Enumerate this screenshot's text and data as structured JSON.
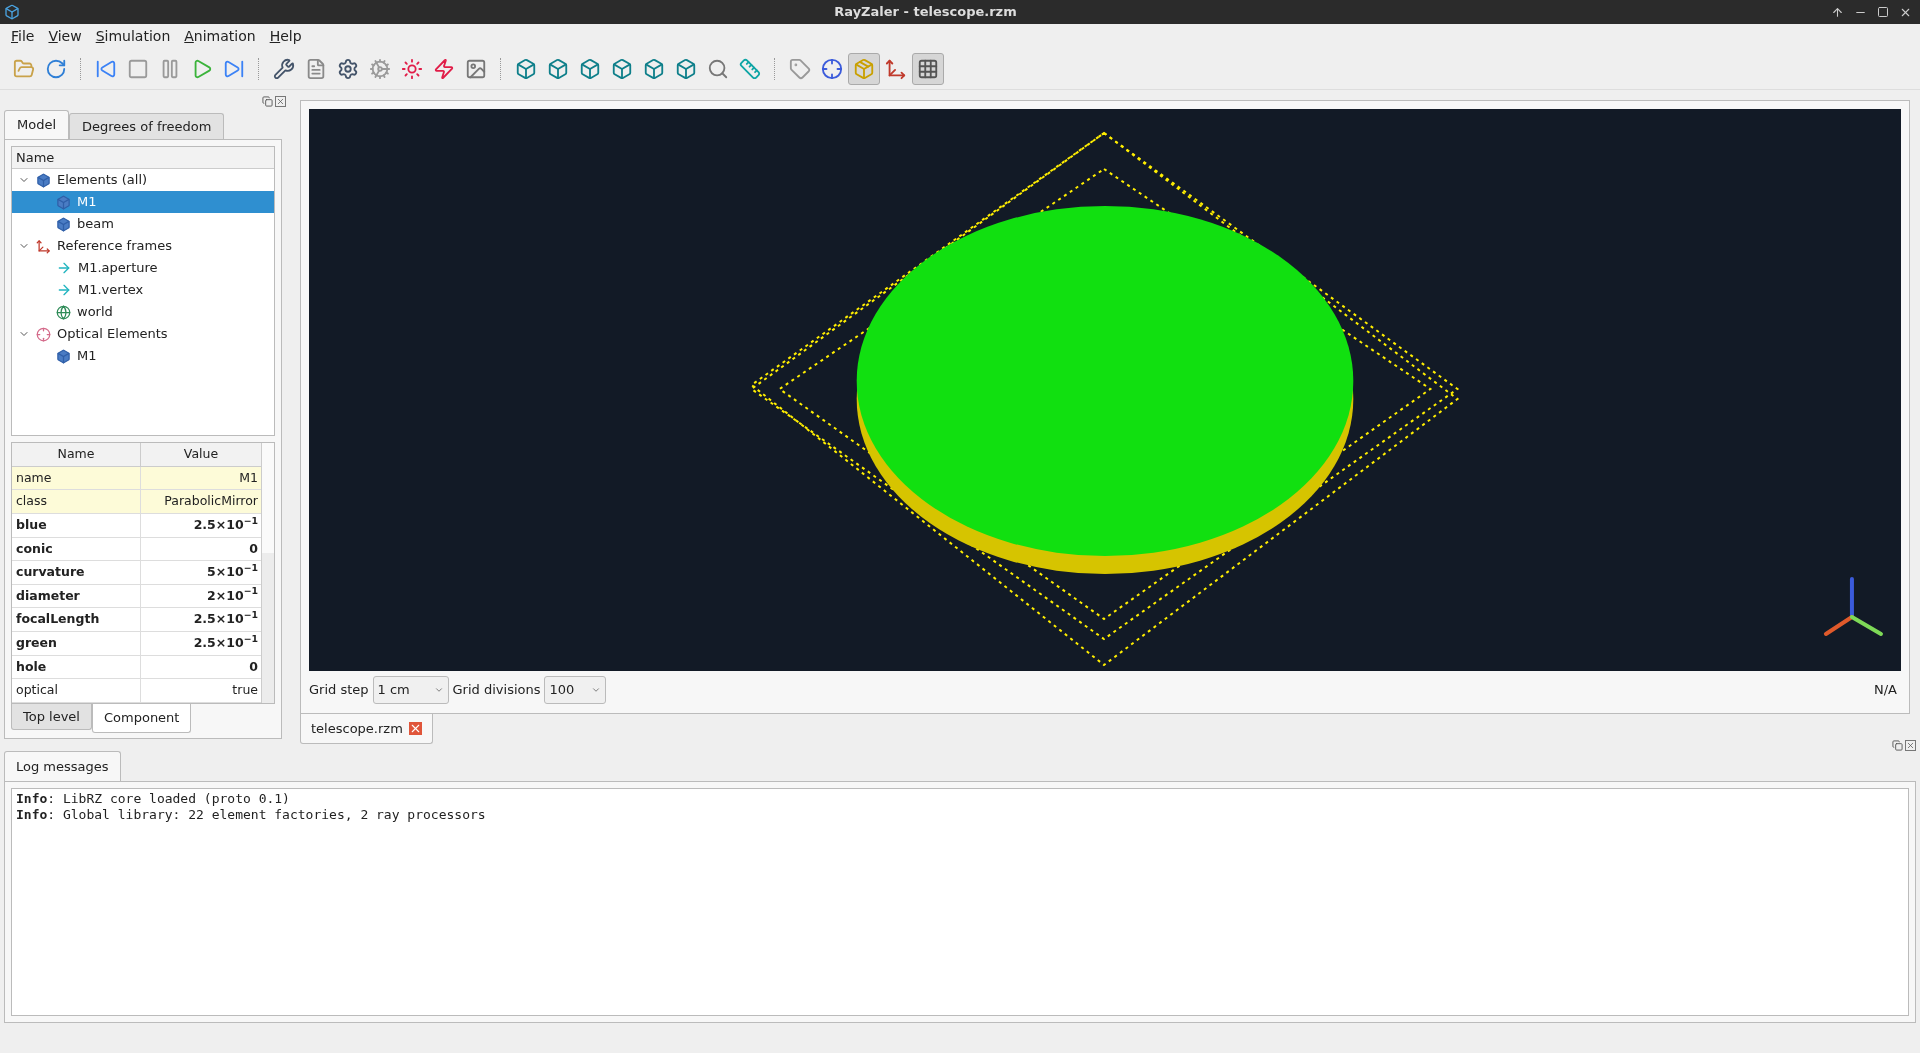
{
  "window": {
    "title": "RayZaler - telescope.rzm"
  },
  "menu": [
    {
      "label": "File"
    },
    {
      "label": "View"
    },
    {
      "label": "Simulation"
    },
    {
      "label": "Animation"
    },
    {
      "label": "Help"
    }
  ],
  "toolbar": [
    [
      {
        "kind": "open",
        "selected": false
      },
      {
        "kind": "reload",
        "selected": false
      }
    ],
    [
      {
        "kind": "rewind",
        "selected": false
      },
      {
        "kind": "stop",
        "selected": false
      },
      {
        "kind": "pause",
        "selected": false
      },
      {
        "kind": "play",
        "selected": false
      },
      {
        "kind": "forward",
        "selected": false
      }
    ],
    [
      {
        "kind": "tools",
        "selected": false
      },
      {
        "kind": "document",
        "selected": false
      },
      {
        "kind": "settings",
        "selected": false
      },
      {
        "kind": "gear",
        "selected": false
      },
      {
        "kind": "laser",
        "selected": false
      },
      {
        "kind": "beam",
        "selected": false
      },
      {
        "kind": "image",
        "selected": false
      }
    ],
    [
      {
        "kind": "cube",
        "selected": false
      },
      {
        "kind": "cube",
        "selected": false
      },
      {
        "kind": "cube",
        "selected": false
      },
      {
        "kind": "cube",
        "selected": false
      },
      {
        "kind": "cube",
        "selected": false
      },
      {
        "kind": "cube",
        "selected": false
      },
      {
        "kind": "zoom",
        "selected": false
      },
      {
        "kind": "ruler",
        "selected": false
      }
    ],
    [
      {
        "kind": "tag",
        "selected": false
      },
      {
        "kind": "crosshair",
        "selected": false
      },
      {
        "kind": "box",
        "selected": true
      },
      {
        "kind": "axes",
        "selected": false
      },
      {
        "kind": "grid",
        "selected": true
      }
    ]
  ],
  "left_tabs": [
    {
      "label": "Model",
      "selected": true
    },
    {
      "label": "Degrees of freedom",
      "selected": false
    }
  ],
  "tree": {
    "header": "Name",
    "items": [
      {
        "label": "Elements (all)",
        "kind": "cube",
        "expanded": true,
        "selected": false,
        "children": [
          {
            "label": "M1",
            "kind": "cube",
            "selected": true
          },
          {
            "label": "beam",
            "kind": "cube",
            "selected": false
          }
        ]
      },
      {
        "label": "Reference frames",
        "kind": "axes",
        "expanded": true,
        "selected": false,
        "children": [
          {
            "label": "M1.aperture",
            "kind": "arrow",
            "selected": false
          },
          {
            "label": "M1.vertex",
            "kind": "arrow",
            "selected": false
          },
          {
            "label": "world",
            "kind": "globe",
            "selected": false
          }
        ]
      },
      {
        "label": "Optical Elements",
        "kind": "lens",
        "expanded": true,
        "selected": false,
        "children": [
          {
            "label": "M1",
            "kind": "cube",
            "selected": false
          }
        ]
      }
    ]
  },
  "properties": {
    "columns": [
      "Name",
      "Value"
    ],
    "rows": [
      {
        "name": "name",
        "value": "M1",
        "kind": "identity",
        "modified": false
      },
      {
        "name": "class",
        "value": "ParabolicMirror",
        "kind": "identity",
        "modified": false
      },
      {
        "name": "blue",
        "value": "2.5×10$^{−1}$",
        "kind": "param",
        "modified": true
      },
      {
        "name": "conic",
        "value": "0",
        "kind": "param",
        "modified": true
      },
      {
        "name": "curvature",
        "value": "5×10$^{−1}$",
        "kind": "param",
        "modified": true
      },
      {
        "name": "diameter",
        "value": "2×10$^{−1}$",
        "kind": "param",
        "modified": true
      },
      {
        "name": "focalLength",
        "value": "2.5×10$^{−1}$",
        "kind": "param",
        "modified": true
      },
      {
        "name": "green",
        "value": "2.5×10$^{−1}$",
        "kind": "param",
        "modified": true
      },
      {
        "name": "hole",
        "value": "0",
        "kind": "param",
        "modified": true
      },
      {
        "name": "optical",
        "value": "true",
        "kind": "param",
        "modified": false
      }
    ]
  },
  "property_tabs": [
    {
      "label": "Top level",
      "selected": false
    },
    {
      "label": "Component",
      "selected": true
    }
  ],
  "viewport": {
    "grid_step": {
      "label": "Grid step",
      "value": "1 cm"
    },
    "grid_divisions": {
      "label": "Grid divisions",
      "value": "100"
    },
    "status": "N/A"
  },
  "document_tabs": [
    {
      "label": "telescope.rzm",
      "selected": true
    }
  ],
  "log": {
    "tab": {
      "label": "Log messages",
      "selected": true
    },
    "lines": [
      "**Info**: LibRZ core loaded (proto 0.1)",
      "**Info**: Global library: 22 element factories, 2 ray processors"
    ]
  }
}
